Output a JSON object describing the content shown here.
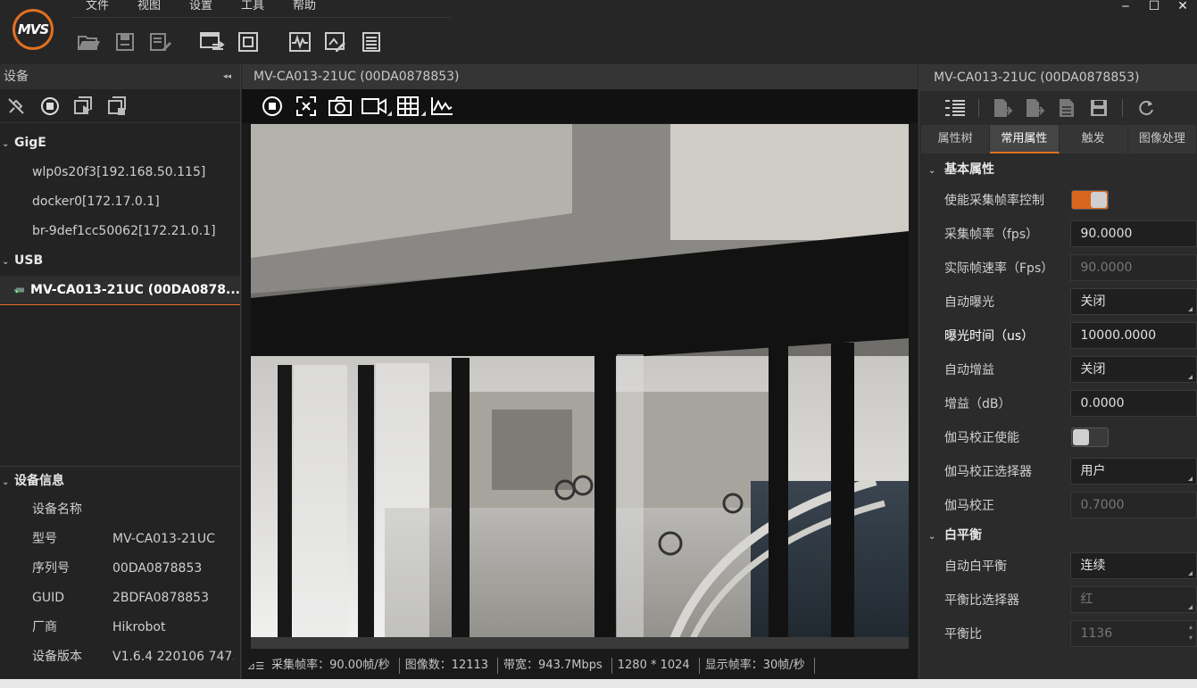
{
  "app": {
    "logo_text": "MVS"
  },
  "menu": [
    "文件",
    "视图",
    "设置",
    "工具",
    "帮助"
  ],
  "window_controls": {
    "minimize": "‒",
    "maximize": "☐",
    "close": "✕"
  },
  "left_panel": {
    "title": "设备",
    "collapse_glyph": "◂◂",
    "groups": [
      {
        "label": "GigE",
        "items": [
          "wlp0s20f3[192.168.50.115]",
          "docker0[172.17.0.1]",
          "br-9def1cc50062[172.21.0.1]"
        ]
      },
      {
        "label": "USB",
        "items": [
          "MV-CA013-21UC (00DA0878..."
        ]
      }
    ],
    "info": {
      "title": "设备信息",
      "rows": [
        {
          "key": "设备名称",
          "value": ""
        },
        {
          "key": "型号",
          "value": "MV-CA013-21UC"
        },
        {
          "key": "序列号",
          "value": "00DA0878853"
        },
        {
          "key": "GUID",
          "value": "2BDFA0878853"
        },
        {
          "key": "厂商",
          "value": "Hikrobot"
        },
        {
          "key": "设备版本",
          "value": "V1.6.4 220106 747..."
        }
      ]
    }
  },
  "center": {
    "title": "MV-CA013-21UC (00DA0878853)",
    "status": {
      "frame_rate": "采集帧率：90.00帧/秒",
      "image_count": "图像数：12113",
      "bandwidth": "带宽：943.7Mbps",
      "resolution": "1280 * 1024",
      "display_rate": "显示帧率：30帧/秒"
    }
  },
  "right_panel": {
    "title": "MV-CA013-21UC (00DA0878853)",
    "tabs": [
      "属性树",
      "常用属性",
      "触发",
      "图像处理"
    ],
    "active_tab": 1,
    "sections": {
      "basic": {
        "title": "基本属性",
        "enable_framerate": {
          "label": "使能采集帧率控制",
          "state": "on"
        },
        "framerate": {
          "label": "采集帧率（fps）",
          "value": "90.0000"
        },
        "actual_framerate": {
          "label": "实际帧速率（Fps）",
          "value": "90.0000"
        },
        "auto_exposure": {
          "label": "自动曝光",
          "value": "关闭"
        },
        "exposure_time": {
          "label": "曝光时间（us）",
          "value": "10000.0000"
        },
        "auto_gain": {
          "label": "自动增益",
          "value": "关闭"
        },
        "gain": {
          "label": "增益（dB）",
          "value": "0.0000"
        },
        "gamma_enable": {
          "label": "伽马校正使能",
          "state": "off"
        },
        "gamma_selector": {
          "label": "伽马校正选择器",
          "value": "用户"
        },
        "gamma": {
          "label": "伽马校正",
          "value": "0.7000"
        }
      },
      "white_balance": {
        "title": "白平衡",
        "auto_wb": {
          "label": "自动白平衡",
          "value": "连续"
        },
        "ratio_selector": {
          "label": "平衡比选择器",
          "value": "红"
        },
        "ratio": {
          "label": "平衡比",
          "value": "1136"
        }
      }
    }
  },
  "colors": {
    "accent": "#e07020",
    "bg": "#262626",
    "panel": "#2b2b2b"
  }
}
